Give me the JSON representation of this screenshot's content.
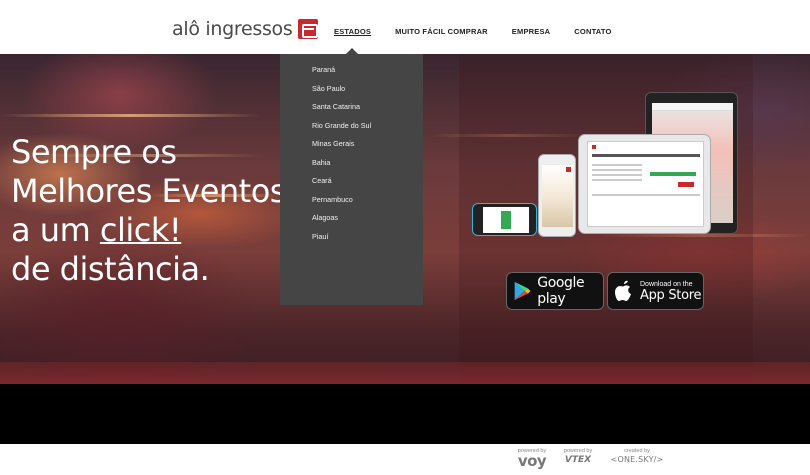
{
  "header": {
    "logo_text": "alô ingressos",
    "nav": [
      {
        "label": "ESTADOS"
      },
      {
        "label": "MUITO FÁCIL COMPRAR"
      },
      {
        "label": "EMPRESA"
      },
      {
        "label": "CONTATO"
      }
    ]
  },
  "dropdown": {
    "items": [
      "Paraná",
      "São Paulo",
      "Santa Catarina",
      "Rio Grande do Sul",
      "Minas Gerais",
      "Bahia",
      "Ceará",
      "Pernambuco",
      "Alagoas",
      "Piauí"
    ]
  },
  "hero": {
    "line1": "Sempre os",
    "line2": "Melhores Eventos",
    "line3_prefix": "a um ",
    "line3_link": "click!",
    "line4": "de distância."
  },
  "badges": {
    "google": "Google play",
    "apple_small": "Download on the",
    "apple_big": "App Store"
  },
  "footer": {
    "voy_label": "powered by",
    "voy_brand": "voy",
    "vtex_label": "powered by",
    "vtex_brand": "VTEX",
    "onesky_label": "created by",
    "onesky_brand": "<ONE.SKY/>"
  },
  "colors": {
    "brand_red": "#c8282e",
    "dropdown_bg": "#454545",
    "band": "#000000"
  }
}
